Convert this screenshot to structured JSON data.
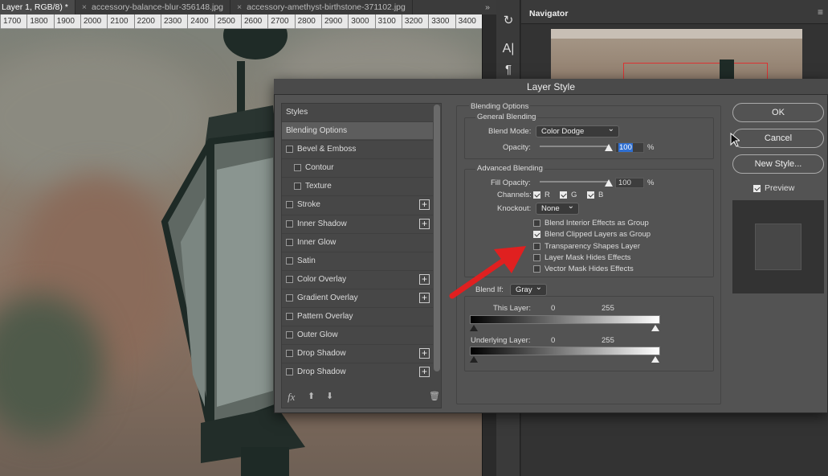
{
  "tabs": [
    {
      "label": "Layer 1, RGB/8) *",
      "active": true
    },
    {
      "label": "accessory-balance-blur-356148.jpg",
      "active": false
    },
    {
      "label": "accessory-amethyst-birthstone-371102.jpg",
      "active": false
    }
  ],
  "tab_overflow": "»",
  "panel_menu": "≡",
  "ruler_ticks": [
    "1700",
    "1800",
    "1900",
    "2000",
    "2100",
    "2200",
    "2300",
    "2400",
    "2500",
    "2600",
    "2700",
    "2800",
    "2900",
    "3000",
    "3100",
    "3200",
    "3300",
    "3400"
  ],
  "navigator": {
    "title": "Navigator"
  },
  "dialog": {
    "title": "Layer Style",
    "styles_header": "Styles",
    "style_items": [
      {
        "label": "Blending Options",
        "selected": true,
        "checkbox": false,
        "sub": false,
        "plus": false
      },
      {
        "label": "Bevel & Emboss",
        "checkbox": true,
        "sub": false,
        "plus": false
      },
      {
        "label": "Contour",
        "checkbox": true,
        "sub": true,
        "plus": false
      },
      {
        "label": "Texture",
        "checkbox": true,
        "sub": true,
        "plus": false
      },
      {
        "label": "Stroke",
        "checkbox": true,
        "sub": false,
        "plus": true
      },
      {
        "label": "Inner Shadow",
        "checkbox": true,
        "sub": false,
        "plus": true
      },
      {
        "label": "Inner Glow",
        "checkbox": true,
        "sub": false,
        "plus": false
      },
      {
        "label": "Satin",
        "checkbox": true,
        "sub": false,
        "plus": false
      },
      {
        "label": "Color Overlay",
        "checkbox": true,
        "sub": false,
        "plus": true
      },
      {
        "label": "Gradient Overlay",
        "checkbox": true,
        "sub": false,
        "plus": true
      },
      {
        "label": "Pattern Overlay",
        "checkbox": true,
        "sub": false,
        "plus": false
      },
      {
        "label": "Outer Glow",
        "checkbox": true,
        "sub": false,
        "plus": false
      },
      {
        "label": "Drop Shadow",
        "checkbox": true,
        "sub": false,
        "plus": true
      },
      {
        "label": "Drop Shadow",
        "checkbox": true,
        "sub": false,
        "plus": true
      }
    ],
    "fx_label": "fx",
    "blending": {
      "title": "Blending Options",
      "general_title": "General Blending",
      "blend_mode_label": "Blend Mode:",
      "blend_mode_value": "Color Dodge",
      "opacity_label": "Opacity:",
      "opacity_value": "100",
      "opacity_level": 1.0,
      "percent": "%",
      "advanced_title": "Advanced Blending",
      "fill_opacity_label": "Fill Opacity:",
      "fill_opacity_value": "100",
      "fill_opacity_level": 1.0,
      "channels_label": "Channels:",
      "channels": [
        {
          "label": "R",
          "checked": true
        },
        {
          "label": "G",
          "checked": true
        },
        {
          "label": "B",
          "checked": true
        }
      ],
      "knockout_label": "Knockout:",
      "knockout_value": "None",
      "options": [
        {
          "label": "Blend Interior Effects as Group",
          "checked": false
        },
        {
          "label": "Blend Clipped Layers as Group",
          "checked": true
        },
        {
          "label": "Transparency Shapes Layer",
          "checked": false
        },
        {
          "label": "Layer Mask Hides Effects",
          "checked": false
        },
        {
          "label": "Vector Mask Hides Effects",
          "checked": false
        }
      ],
      "blend_if_label": "Blend If:",
      "blend_if_value": "Gray",
      "this_layer_label": "This Layer:",
      "this_layer_min": "0",
      "this_layer_max": "255",
      "underlying_label": "Underlying Layer:",
      "underlying_min": "0",
      "underlying_max": "255"
    },
    "buttons": {
      "ok": "OK",
      "cancel": "Cancel",
      "new_style": "New Style...",
      "preview": "Preview",
      "preview_checked": true
    }
  },
  "colors": {
    "arrow": "#e02020",
    "dialog_bg": "#535353",
    "selection": "#2f6fd1"
  }
}
